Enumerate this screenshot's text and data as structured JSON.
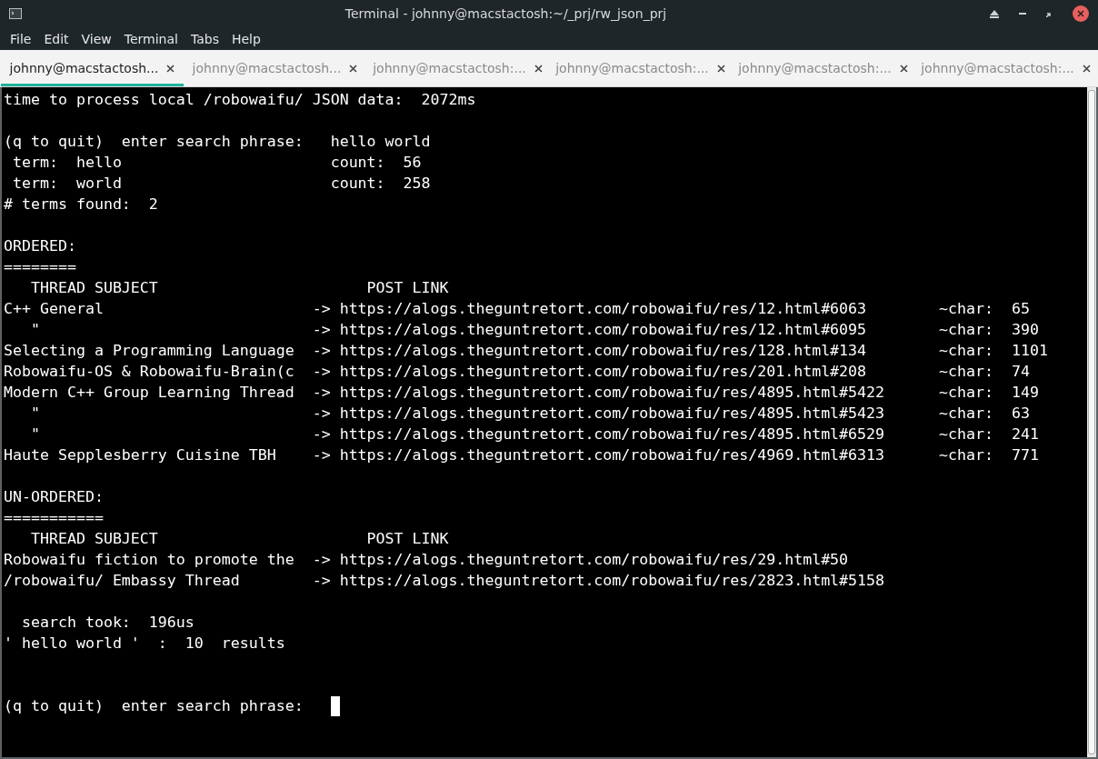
{
  "window": {
    "title": "Terminal - johnny@macstactosh:~/_prj/rw_json_prj"
  },
  "menu": [
    "File",
    "Edit",
    "View",
    "Terminal",
    "Tabs",
    "Help"
  ],
  "tabs": [
    {
      "label": "johnny@macstactosh...",
      "selected": true
    },
    {
      "label": "johnny@macstactosh...",
      "selected": false
    },
    {
      "label": "johnny@macstactosh:...",
      "selected": false
    },
    {
      "label": "johnny@macstactosh:...",
      "selected": false
    },
    {
      "label": "johnny@macstactosh:...",
      "selected": false
    },
    {
      "label": "johnny@macstactosh:...",
      "selected": false
    }
  ],
  "terminal": {
    "lines": [
      {
        "kind": "text",
        "text": "time to process local /robowaifu/ JSON data:  2072ms"
      },
      {
        "kind": "blank"
      },
      {
        "kind": "text",
        "text": "(q to quit)  enter search phrase:   hello world"
      },
      {
        "kind": "text",
        "text": " term:  hello                       count:  56"
      },
      {
        "kind": "text",
        "text": " term:  world                       count:  258"
      },
      {
        "kind": "text",
        "text": "# terms found:  2"
      },
      {
        "kind": "blank"
      },
      {
        "kind": "text",
        "text": "ORDERED:"
      },
      {
        "kind": "text",
        "text": "========"
      },
      {
        "kind": "text",
        "text": "   THREAD SUBJECT                       POST LINK"
      },
      {
        "kind": "text",
        "text": "C++ General                       -> https://alogs.theguntretort.com/robowaifu/res/12.html#6063        ~char:  65"
      },
      {
        "kind": "text",
        "text": "   \"                              -> https://alogs.theguntretort.com/robowaifu/res/12.html#6095        ~char:  390"
      },
      {
        "kind": "text",
        "text": "Selecting a Programming Language  -> https://alogs.theguntretort.com/robowaifu/res/128.html#134        ~char:  1101"
      },
      {
        "kind": "text",
        "text": "Robowaifu-OS & Robowaifu-Brain(c  -> https://alogs.theguntretort.com/robowaifu/res/201.html#208        ~char:  74"
      },
      {
        "kind": "text",
        "text": "Modern C++ Group Learning Thread  -> https://alogs.theguntretort.com/robowaifu/res/4895.html#5422      ~char:  149"
      },
      {
        "kind": "text",
        "text": "   \"                              -> https://alogs.theguntretort.com/robowaifu/res/4895.html#5423      ~char:  63"
      },
      {
        "kind": "text",
        "text": "   \"                              -> https://alogs.theguntretort.com/robowaifu/res/4895.html#6529      ~char:  241"
      },
      {
        "kind": "text",
        "text": "Haute Sepplesberry Cuisine TBH    -> https://alogs.theguntretort.com/robowaifu/res/4969.html#6313      ~char:  771"
      },
      {
        "kind": "blank"
      },
      {
        "kind": "text",
        "text": "UN-ORDERED:"
      },
      {
        "kind": "text",
        "text": "==========="
      },
      {
        "kind": "text",
        "text": "   THREAD SUBJECT                       POST LINK"
      },
      {
        "kind": "text",
        "text": "Robowaifu fiction to promote the  -> https://alogs.theguntretort.com/robowaifu/res/29.html#50"
      },
      {
        "kind": "text",
        "text": "/robowaifu/ Embassy Thread        -> https://alogs.theguntretort.com/robowaifu/res/2823.html#5158"
      },
      {
        "kind": "blank"
      },
      {
        "kind": "text",
        "text": "  search took:  196us"
      },
      {
        "kind": "text",
        "text": "' hello world '  :  10  results"
      },
      {
        "kind": "blank"
      },
      {
        "kind": "blank"
      },
      {
        "kind": "prompt",
        "text": "(q to quit)  enter search phrase:   "
      }
    ]
  }
}
